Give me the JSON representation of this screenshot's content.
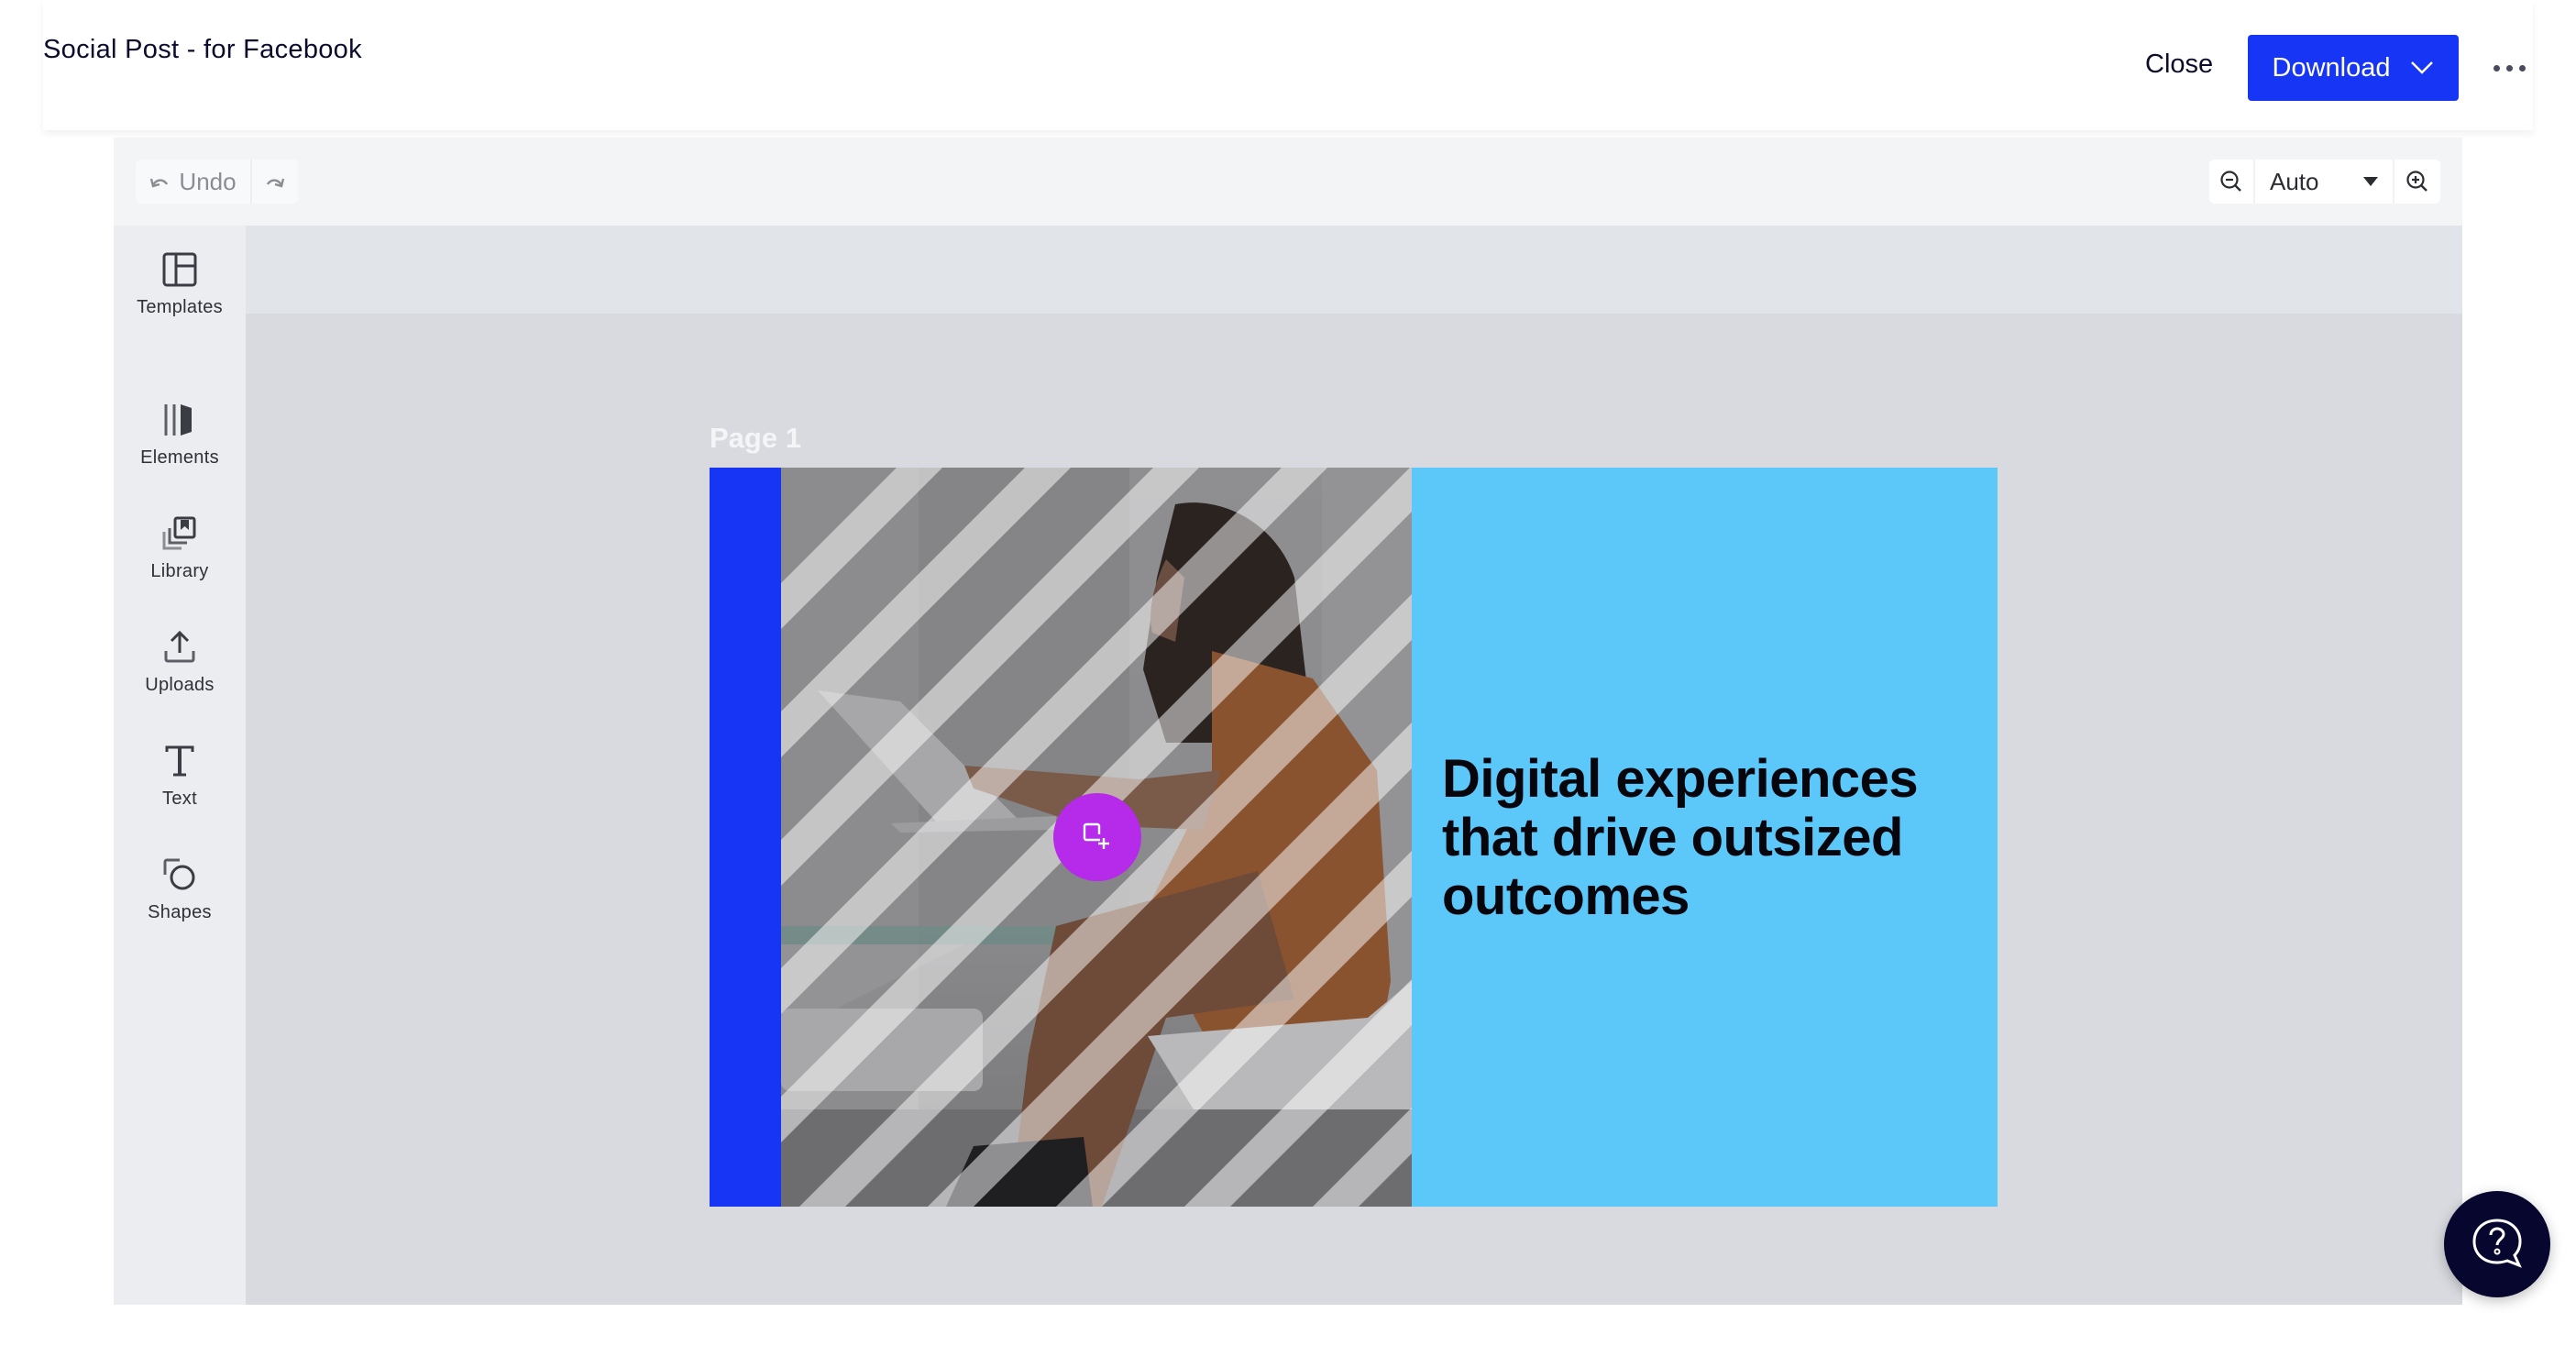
{
  "header": {
    "title": "Social Post - for Facebook",
    "close_label": "Close",
    "download_label": "Download",
    "download_icon": "chevron-down-icon",
    "more_icon": "more-horizontal-icon"
  },
  "toolbar": {
    "undo_label": "Undo",
    "undo_icon": "undo-icon",
    "redo_icon": "redo-icon",
    "zoom_out_icon": "zoom-out-icon",
    "zoom_value": "Auto",
    "zoom_in_icon": "zoom-in-icon"
  },
  "sidebar": {
    "items": [
      {
        "label": "Templates",
        "icon": "templates-icon"
      },
      {
        "label": "Elements",
        "icon": "elements-icon"
      },
      {
        "label": "Library",
        "icon": "library-icon"
      },
      {
        "label": "Uploads",
        "icon": "upload-icon"
      },
      {
        "label": "Text",
        "icon": "text-icon"
      },
      {
        "label": "Shapes",
        "icon": "shapes-icon"
      }
    ]
  },
  "canvas": {
    "page_label": "Page 1",
    "design": {
      "headline": "Digital experiences that drive outsized outcomes",
      "photo_description": "Woman in brown dress sitting at glass table typing on laptop, overlaid with diagonal white stripes",
      "colors": {
        "strip": "#1735f5",
        "panel": "#5bc8f9",
        "headline": "#06060c"
      }
    },
    "add_element_icon": "add-frame-icon"
  },
  "help": {
    "icon": "help-chat-icon"
  },
  "colors": {
    "primary": "#1735f5",
    "accent_purple": "#b62aea",
    "help_bg": "#07062e"
  }
}
